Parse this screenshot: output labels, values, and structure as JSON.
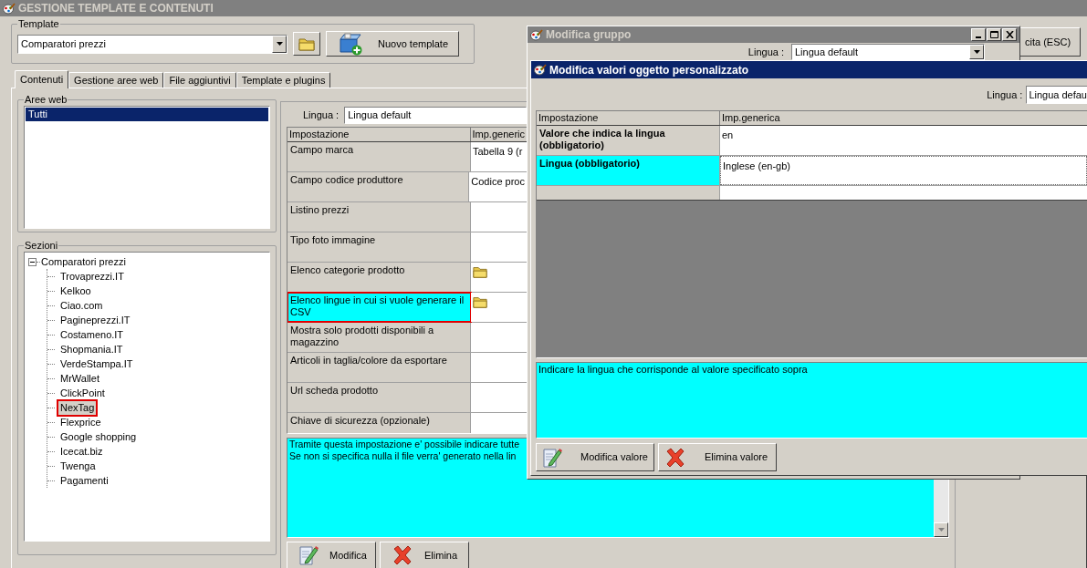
{
  "main_window": {
    "title": "GESTIONE TEMPLATE E CONTENUTI",
    "active": false,
    "template": {
      "label": "Template",
      "value": "Comparatori prezzi"
    },
    "new_template_button": "Nuovo template",
    "exit_button": "cita (ESC)",
    "tabs": [
      {
        "label": "Contenuti",
        "selected": true
      },
      {
        "label": "Gestione aree web",
        "selected": false
      },
      {
        "label": "File aggiuntivi",
        "selected": false
      },
      {
        "label": "Template e plugins",
        "selected": false
      }
    ],
    "aree_web": {
      "label": "Aree web",
      "items": [
        {
          "label": "Tutti",
          "selected": true
        }
      ]
    },
    "sezioni": {
      "label": "Sezioni",
      "tree": [
        {
          "label": "Comparatori prezzi",
          "expanded": true,
          "selected": false,
          "annotated": false,
          "children": [
            {
              "label": "Trovaprezzi.IT",
              "selected": false,
              "annotated": false
            },
            {
              "label": "Kelkoo",
              "selected": false,
              "annotated": false
            },
            {
              "label": "Ciao.com",
              "selected": false,
              "annotated": false
            },
            {
              "label": "Pagineprezzi.IT",
              "selected": false,
              "annotated": false
            },
            {
              "label": "Costameno.IT",
              "selected": false,
              "annotated": false
            },
            {
              "label": "Shopmania.IT",
              "selected": false,
              "annotated": false
            },
            {
              "label": "VerdeStampa.IT",
              "selected": false,
              "annotated": false
            },
            {
              "label": "MrWallet",
              "selected": false,
              "annotated": false
            },
            {
              "label": "ClickPoint",
              "selected": false,
              "annotated": false
            },
            {
              "label": "NexTag",
              "selected": true,
              "annotated": true
            },
            {
              "label": "Flexprice",
              "selected": false,
              "annotated": false
            },
            {
              "label": "Google shopping",
              "selected": false,
              "annotated": false
            },
            {
              "label": "Icecat.biz",
              "selected": false,
              "annotated": false
            },
            {
              "label": "Twenga",
              "selected": false,
              "annotated": false
            },
            {
              "label": "Pagamenti",
              "selected": false,
              "annotated": false
            }
          ]
        }
      ]
    },
    "settings": {
      "lingua_label": "Lingua :",
      "lingua_value": "Lingua default",
      "columns": [
        "Impostazione",
        "Imp.generic"
      ],
      "rows": [
        {
          "name": "Campo marca",
          "value": "Tabella 9 (r",
          "folder_icon": false,
          "selected": false,
          "annotated": false
        },
        {
          "name": "Campo codice produttore",
          "value": "Codice proc",
          "folder_icon": false,
          "selected": false,
          "annotated": false
        },
        {
          "name": "Listino prezzi",
          "folder_icon": false,
          "selected": false,
          "annotated": false
        },
        {
          "name": "Tipo foto immagine",
          "folder_icon": false,
          "selected": false,
          "annotated": false
        },
        {
          "name": "Elenco categorie prodotto",
          "folder_icon": true,
          "selected": false,
          "annotated": false
        },
        {
          "name": "Elenco lingue in cui si vuole generare il CSV",
          "folder_icon": true,
          "selected": true,
          "annotated": true
        },
        {
          "name": "Mostra solo prodotti disponibili a magazzino",
          "folder_icon": false,
          "selected": false,
          "annotated": false
        },
        {
          "name": "Articoli in taglia/colore da esportare",
          "folder_icon": false,
          "selected": false,
          "annotated": false
        },
        {
          "name": "Url scheda prodotto",
          "folder_icon": false,
          "selected": false,
          "annotated": false
        },
        {
          "name": "Chiave di sicurezza (opzionale)",
          "folder_icon": false,
          "selected": false,
          "annotated": false
        }
      ],
      "description": [
        "Tramite questa impostazione e' possibile indicare tutte",
        "Se non si specifica nulla il file verra' generato nella lin"
      ],
      "buttons": [
        {
          "kind": "edit",
          "label": "Modifica"
        },
        {
          "kind": "delete",
          "label": "Elimina"
        }
      ]
    }
  },
  "group_dialog": {
    "title": "Modifica gruppo",
    "active": false,
    "lingua_label": "Lingua :",
    "lingua_value": "Lingua default"
  },
  "value_dialog": {
    "title": "Modifica valori oggetto personalizzato",
    "active": true,
    "lingua_label": "Lingua :",
    "lingua_value": "Lingua defau",
    "columns": [
      "Impostazione",
      "Imp.generica"
    ],
    "rows": [
      {
        "name": "Valore che indica la lingua (obbligatorio)",
        "value": "en",
        "selected": false
      },
      {
        "name": "Lingua (obbligatorio)",
        "value": "Inglese (en-gb)",
        "selected": true
      }
    ],
    "description": "Indicare la lingua che corrisponde al valore specificato sopra",
    "buttons": [
      {
        "kind": "edit",
        "label": "Modifica valore"
      },
      {
        "kind": "delete",
        "label": "Elimina valore"
      }
    ]
  }
}
